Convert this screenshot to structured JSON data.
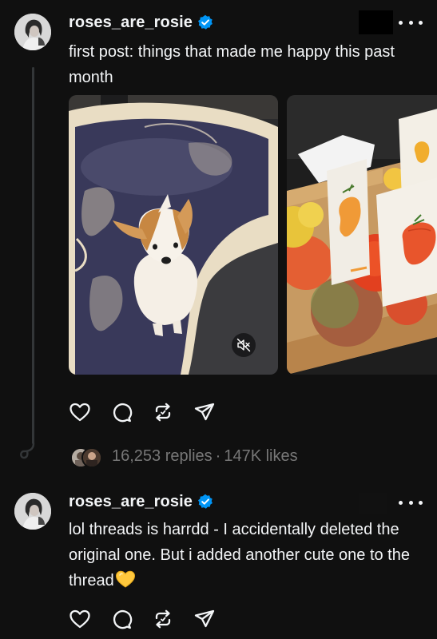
{
  "post1": {
    "username": "roses_are_rosie",
    "text": "first post: things that made me happy this past month",
    "media": [
      {
        "icon": "mute-icon"
      },
      {}
    ],
    "replies": "16,253 replies",
    "separator": "·",
    "likes": "147K likes"
  },
  "post2": {
    "username": "roses_are_rosie",
    "text": "lol threads is harrdd - I accidentally deleted the original one. But i added another cute one to the thread",
    "emoji": "💛"
  },
  "icons": {
    "verified": "verified-badge-icon",
    "more": "more-options-icon",
    "like": "heart-icon",
    "reply": "comment-icon",
    "repost": "repost-icon",
    "share": "send-icon"
  },
  "colors": {
    "background": "#101010",
    "text": "#f3f5f7",
    "muted": "#777777",
    "verified": "#0095f6",
    "thread_line": "#333638"
  }
}
